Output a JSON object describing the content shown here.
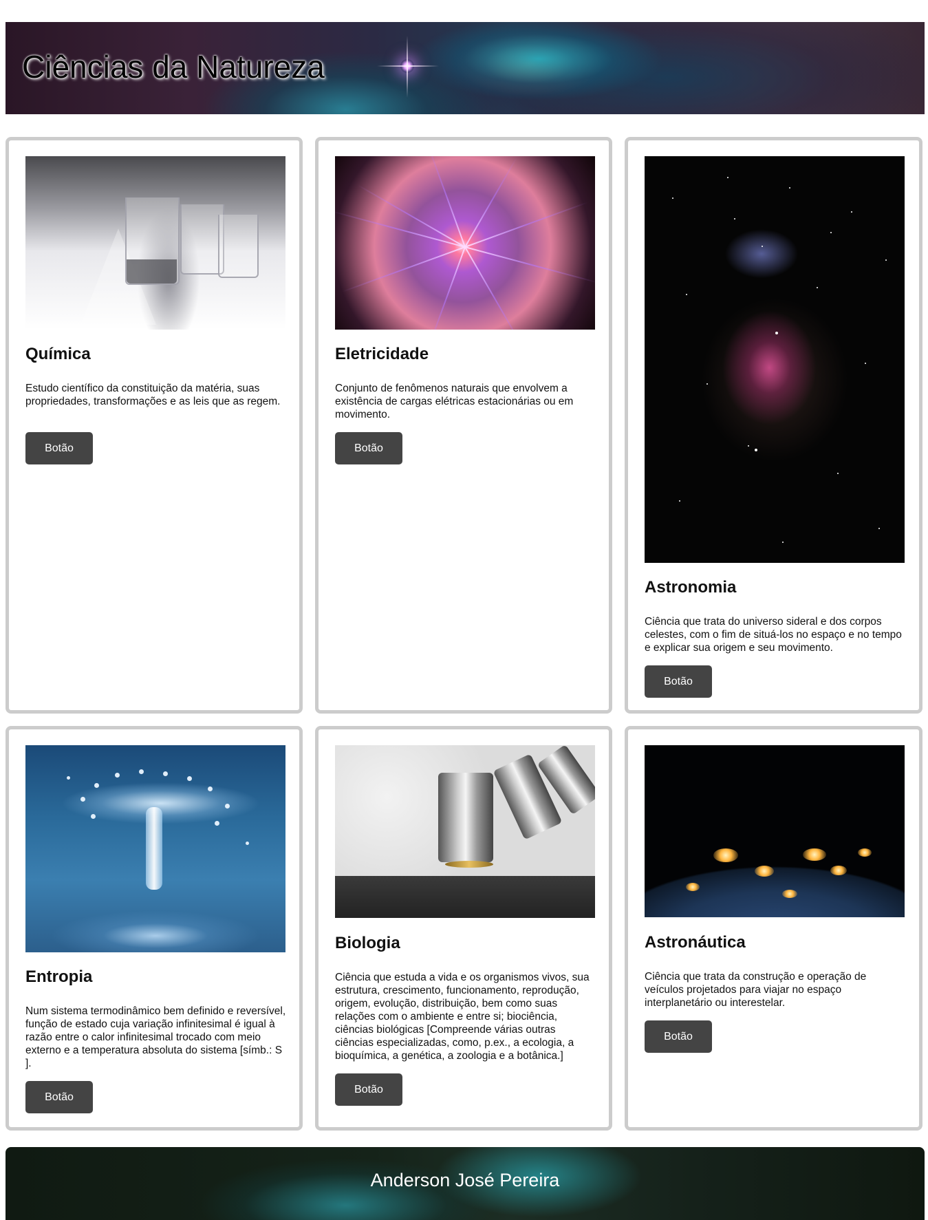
{
  "header": {
    "title": "Ciências da Natureza"
  },
  "cards": [
    {
      "image_name": "laboratory-glassware",
      "title": "Química",
      "description": "Estudo científico da constituição da matéria, suas propriedades, transformações e as leis que as regem.",
      "button_label": "Botão"
    },
    {
      "image_name": "plasma-ball",
      "title": "Eletricidade",
      "description": "Conjunto de fenômenos naturais que envolvem a existência de cargas elétricas estacionárias ou em movimento.",
      "button_label": "Botão"
    },
    {
      "image_name": "orion-nebula",
      "title": "Astronomia",
      "description": "Ciência que trata do universo sideral e dos corpos celestes, com o fim de situá-los no espaço e no tempo e explicar sua origem e seu movimento.",
      "button_label": "Botão"
    },
    {
      "image_name": "water-droplet-splash",
      "title": "Entropia",
      "description": "Num sistema termodinâmico bem definido e reversível, função de estado cuja variação infinitesimal é igual à razão entre o calor infinitesimal trocado com meio externo e a temperatura absoluta do sistema [símb.: S ].",
      "button_label": "Botão"
    },
    {
      "image_name": "microscope",
      "title": "Biologia",
      "description": "Ciência que estuda a vida e os organismos vivos, sua estrutura, crescimento, funcionamento, reprodução, origem, evolução, distribuição, bem como suas relações com o ambiente e entre si; biociência, ciências biológicas [Compreende várias outras ciências especializadas, como, p.ex., a ecologia, a bioquímica, a genética, a zoologia e a botânica.]",
      "button_label": "Botão"
    },
    {
      "image_name": "earth-at-night",
      "title": "Astronáutica",
      "description": "Ciência que trata da construção e operação de veículos projetados para viajar no espaço interplanetário ou interestelar.",
      "button_label": "Botão"
    }
  ],
  "footer": {
    "author": "Anderson José Pereira"
  }
}
